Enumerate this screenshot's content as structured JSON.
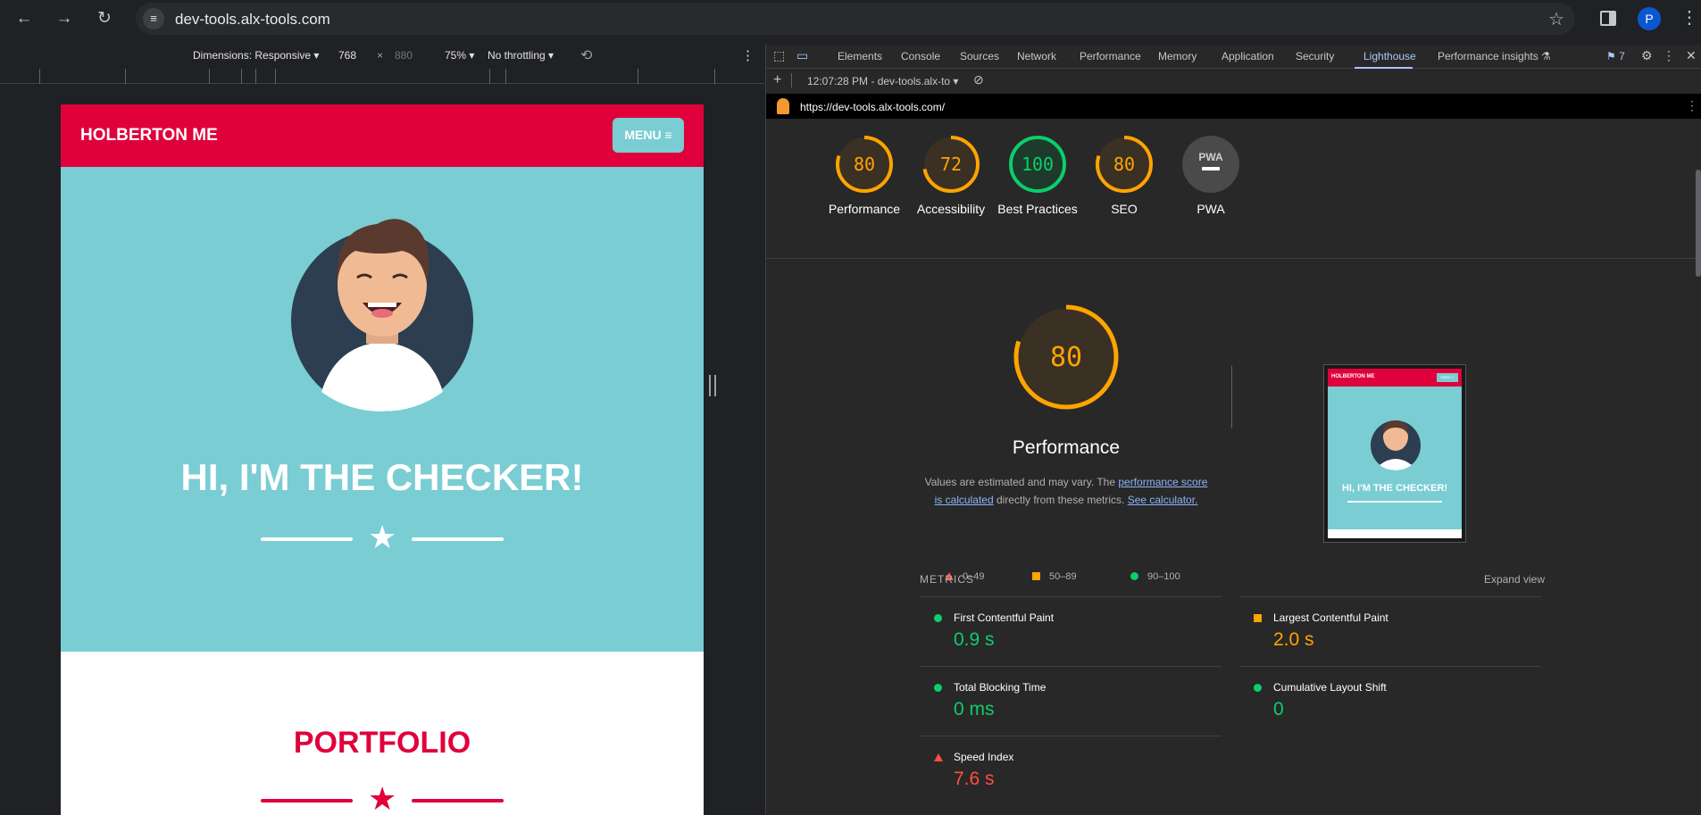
{
  "browser": {
    "url": "dev-tools.alx-tools.com",
    "profile_initial": "P",
    "back_icon": "←",
    "forward_icon": "→",
    "reload_icon": "↻",
    "star_icon": "☆",
    "menu_icon": "⋮"
  },
  "device_toolbar": {
    "dimensions": "Dimensions: Responsive ▾",
    "width": "768",
    "times": "×",
    "height": "880",
    "zoom": "75% ▾",
    "throttling": "No throttling ▾",
    "more_icon": "⋮"
  },
  "page": {
    "brand": "HOLBERTON ME",
    "menu_label": "MENU ≡",
    "hero_title": "HI, I'M THE CHECKER!",
    "star": "★",
    "portfolio_title": "PORTFOLIO",
    "colors": {
      "primary": "#e0003b",
      "hero": "#79cdd3"
    }
  },
  "devtools": {
    "tabs": [
      "Elements",
      "Console",
      "Sources",
      "Network",
      "Performance",
      "Memory",
      "Application",
      "Security",
      "Lighthouse",
      "Performance insights ⚗"
    ],
    "active_tab": "Lighthouse",
    "issues_count": "7",
    "report_time": "12:07:28 PM - dev-tools.alx-to ▾",
    "report_url": "https://dev-tools.alx-tools.com/"
  },
  "lighthouse": {
    "gauges": [
      {
        "label": "Performance",
        "score": 80,
        "color": "#ffa400"
      },
      {
        "label": "Accessibility",
        "score": 72,
        "color": "#ffa400"
      },
      {
        "label": "Best Practices",
        "score": 100,
        "color": "#0cce6b"
      },
      {
        "label": "SEO",
        "score": 80,
        "color": "#ffa400"
      },
      {
        "label": "PWA",
        "score": null,
        "color": "#9aa0a6"
      }
    ],
    "pwa_text": "PWA",
    "big_score": "80",
    "perf_title": "Performance",
    "desc_pre": "Values are estimated and may vary. The ",
    "desc_link1": "performance score is calculated",
    "desc_mid": " directly from these metrics. ",
    "desc_link2": "See calculator.",
    "legend": [
      "0–49",
      "50–89",
      "90–100"
    ],
    "thumb_brand": "HOLBERTON ME",
    "thumb_btn": "MENU ≡",
    "thumb_title": "HI, I'M THE CHECKER!",
    "metrics_label": "METRICS",
    "expand_label": "Expand view",
    "metrics": [
      {
        "name": "First Contentful Paint",
        "value": "0.9 s",
        "status": "pass"
      },
      {
        "name": "Largest Contentful Paint",
        "value": "2.0 s",
        "status": "average"
      },
      {
        "name": "Total Blocking Time",
        "value": "0 ms",
        "status": "pass"
      },
      {
        "name": "Cumulative Layout Shift",
        "value": "0",
        "status": "pass"
      },
      {
        "name": "Speed Index",
        "value": "7.6 s",
        "status": "fail"
      }
    ],
    "status_colors": {
      "pass": "#0cce6b",
      "average": "#ffa400",
      "fail": "#ff4e42"
    }
  }
}
